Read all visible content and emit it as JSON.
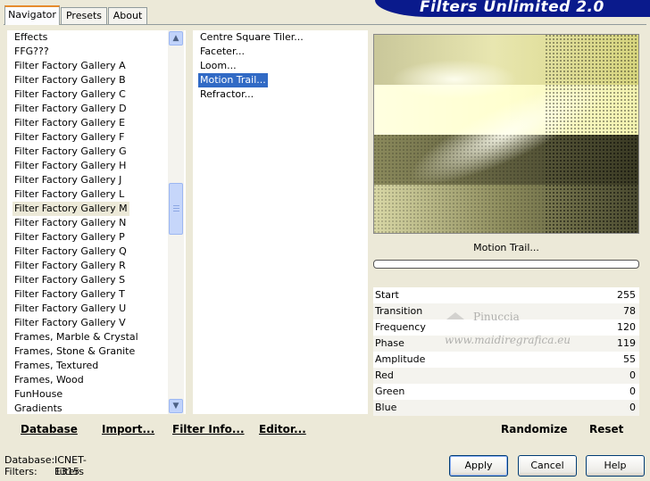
{
  "tabs": [
    "Navigator",
    "Presets",
    "About"
  ],
  "header": {
    "title": "Filters Unlimited 2.0"
  },
  "categories": [
    "Effects",
    "FFG???",
    "Filter Factory Gallery A",
    "Filter Factory Gallery B",
    "Filter Factory Gallery C",
    "Filter Factory Gallery D",
    "Filter Factory Gallery E",
    "Filter Factory Gallery F",
    "Filter Factory Gallery G",
    "Filter Factory Gallery H",
    "Filter Factory Gallery J",
    "Filter Factory Gallery L",
    "Filter Factory Gallery M",
    "Filter Factory Gallery N",
    "Filter Factory Gallery P",
    "Filter Factory Gallery Q",
    "Filter Factory Gallery R",
    "Filter Factory Gallery S",
    "Filter Factory Gallery T",
    "Filter Factory Gallery U",
    "Filter Factory Gallery V",
    "Frames, Marble & Crystal",
    "Frames, Stone & Granite",
    "Frames, Textured",
    "Frames, Wood",
    "FunHouse",
    "Gradients"
  ],
  "selected_category": "Filter Factory Gallery M",
  "filters": [
    "Centre Square Tiler...",
    "Faceter...",
    "Loom...",
    "Motion Trail...",
    "Refractor..."
  ],
  "selected_filter": "Motion Trail...",
  "left_buttons": {
    "database": "Database",
    "import": "Import...",
    "filter_info": "Filter Info...",
    "editor": "Editor..."
  },
  "filter_title": "Motion Trail...",
  "progress": 0,
  "params": [
    {
      "label": "Start",
      "value": "255"
    },
    {
      "label": "Transition",
      "value": "78"
    },
    {
      "label": "Frequency",
      "value": "120"
    },
    {
      "label": "Phase",
      "value": "119"
    },
    {
      "label": "Amplitude",
      "value": "55"
    },
    {
      "label": "Red",
      "value": "0"
    },
    {
      "label": "Green",
      "value": "0"
    },
    {
      "label": "Blue",
      "value": "0"
    }
  ],
  "watermark": {
    "line1": "Pinuccia",
    "line2": "www.maidiregrafica.eu"
  },
  "right_buttons": {
    "randomize": "Randomize",
    "reset": "Reset"
  },
  "status": {
    "database_label": "Database:",
    "database_value": "ICNET-Filters",
    "filters_label": "Filters:",
    "filters_value": "1315"
  },
  "dialog_buttons": {
    "apply": "Apply",
    "cancel": "Cancel",
    "help": "Help"
  },
  "colors": {
    "selection": "#316AC5",
    "banner": "#0A1A8C",
    "tab_accent": "#E68B2C"
  },
  "icons": {
    "scroll_up": "chevron-up-icon",
    "scroll_down": "chevron-down-icon"
  }
}
